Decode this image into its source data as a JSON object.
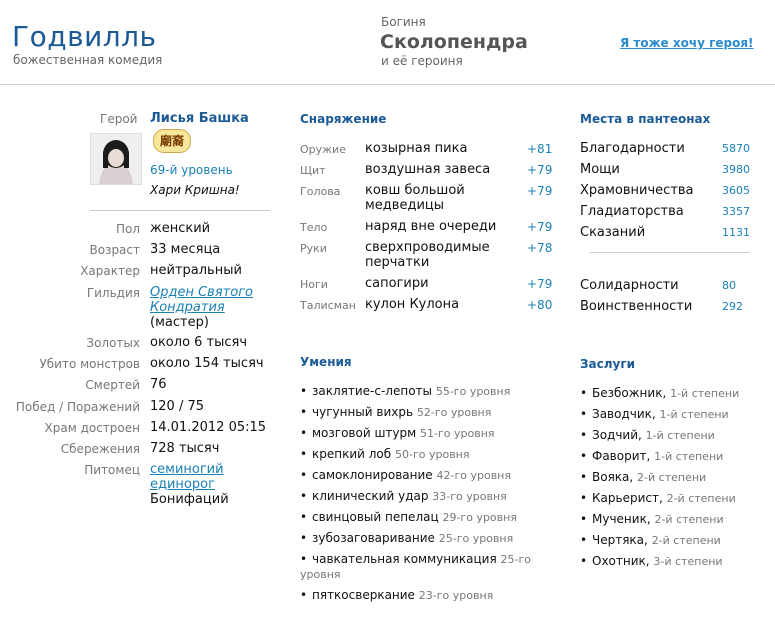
{
  "header": {
    "logo_title": "Годвилль",
    "logo_subtitle": "божественная комедия",
    "god_caption": "Богиня",
    "god_name": "Сколопендра",
    "god_subtitle": "и её героиня",
    "cta_link": "Я тоже хочу героя!"
  },
  "hero": {
    "label": "Герой",
    "name": "Лисья Башка",
    "badge": "廟裔",
    "level": "69-й уровень",
    "motto": "Хари Кришна!",
    "stats": [
      {
        "label": "Пол",
        "value": "женский"
      },
      {
        "label": "Возраст",
        "value": "33 месяца"
      },
      {
        "label": "Характер",
        "value": "нейтральный"
      },
      {
        "label": "Гильдия",
        "value_link_1": "Орден Святого",
        "value_link_2": "Кондратия",
        "value_extra": "(мастер)"
      },
      {
        "label": "Золотых",
        "value": "около 6 тысяч"
      },
      {
        "label": "Убито монстров",
        "value": "около 154 тысяч"
      },
      {
        "label": "Смертей",
        "value": "76"
      },
      {
        "label": "Побед / Поражений",
        "value": "120 / 75"
      },
      {
        "label": "Храм достроен",
        "value": "14.01.2012 05:15"
      },
      {
        "label": "Сбережения",
        "value": "728 тысяч"
      },
      {
        "label": "Питомец",
        "value_link_1": "семиногий",
        "value_link_2": "единорог",
        "value_extra": "Бонифаций"
      }
    ]
  },
  "equipment": {
    "title": "Снаряжение",
    "items": [
      {
        "slot": "Оружие",
        "name": "козырная пика",
        "bonus": "+81"
      },
      {
        "slot": "Щит",
        "name": "воздушная завеса",
        "bonus": "+79"
      },
      {
        "slot": "Голова",
        "name": "ковш большой медведицы",
        "bonus": "+79"
      },
      {
        "slot": "Тело",
        "name": "наряд вне очереди",
        "bonus": "+79"
      },
      {
        "slot": "Руки",
        "name": "сверхпроводимые перчатки",
        "bonus": "+78"
      },
      {
        "slot": "Ноги",
        "name": "сапогири",
        "bonus": "+79"
      },
      {
        "slot": "Талисман",
        "name": "кулон Кулона",
        "bonus": "+80"
      }
    ]
  },
  "skills": {
    "title": "Умения",
    "items": [
      {
        "name": "заклятие-с-лепоты",
        "level": "55-го уровня"
      },
      {
        "name": "чугунный вихрь",
        "level": "52-го уровня"
      },
      {
        "name": "мозговой штурм",
        "level": "51-го уровня"
      },
      {
        "name": "крепкий лоб",
        "level": "50-го уровня"
      },
      {
        "name": "самоклонирование",
        "level": "42-го уровня"
      },
      {
        "name": "клинический удар",
        "level": "33-го уровня"
      },
      {
        "name": "свинцовый пепелац",
        "level": "29-го уровня"
      },
      {
        "name": "зубозаговаривание",
        "level": "25-го уровня"
      },
      {
        "name": "чавкательная коммуникация",
        "level": "25-го уровня"
      },
      {
        "name": "пяткосверкание",
        "level": "23-го уровня"
      }
    ]
  },
  "pantheons": {
    "title": "Места в пантеонах",
    "items": [
      {
        "name": "Благодарности",
        "value": "5870"
      },
      {
        "name": "Мощи",
        "value": "3980"
      },
      {
        "name": "Храмовничества",
        "value": "3605"
      },
      {
        "name": "Гладиаторства",
        "value": "3357"
      },
      {
        "name": "Сказаний",
        "value": "1131"
      }
    ],
    "items2": [
      {
        "name": "Солидарности",
        "value": "80"
      },
      {
        "name": "Воинственности",
        "value": "292"
      }
    ]
  },
  "merits": {
    "title": "Заслуги",
    "items": [
      {
        "name": "Безбожник",
        "degree": "1-й степени"
      },
      {
        "name": "Заводчик",
        "degree": "1-й степени"
      },
      {
        "name": "Зодчий",
        "degree": "1-й степени"
      },
      {
        "name": "Фаворит",
        "degree": "1-й степени"
      },
      {
        "name": "Вояка",
        "degree": "2-й степени"
      },
      {
        "name": "Карьерист",
        "degree": "2-й степени"
      },
      {
        "name": "Мученик",
        "degree": "2-й степени"
      },
      {
        "name": "Чертяка",
        "degree": "2-й степени"
      },
      {
        "name": "Охотник",
        "degree": "3-й степени"
      }
    ]
  }
}
